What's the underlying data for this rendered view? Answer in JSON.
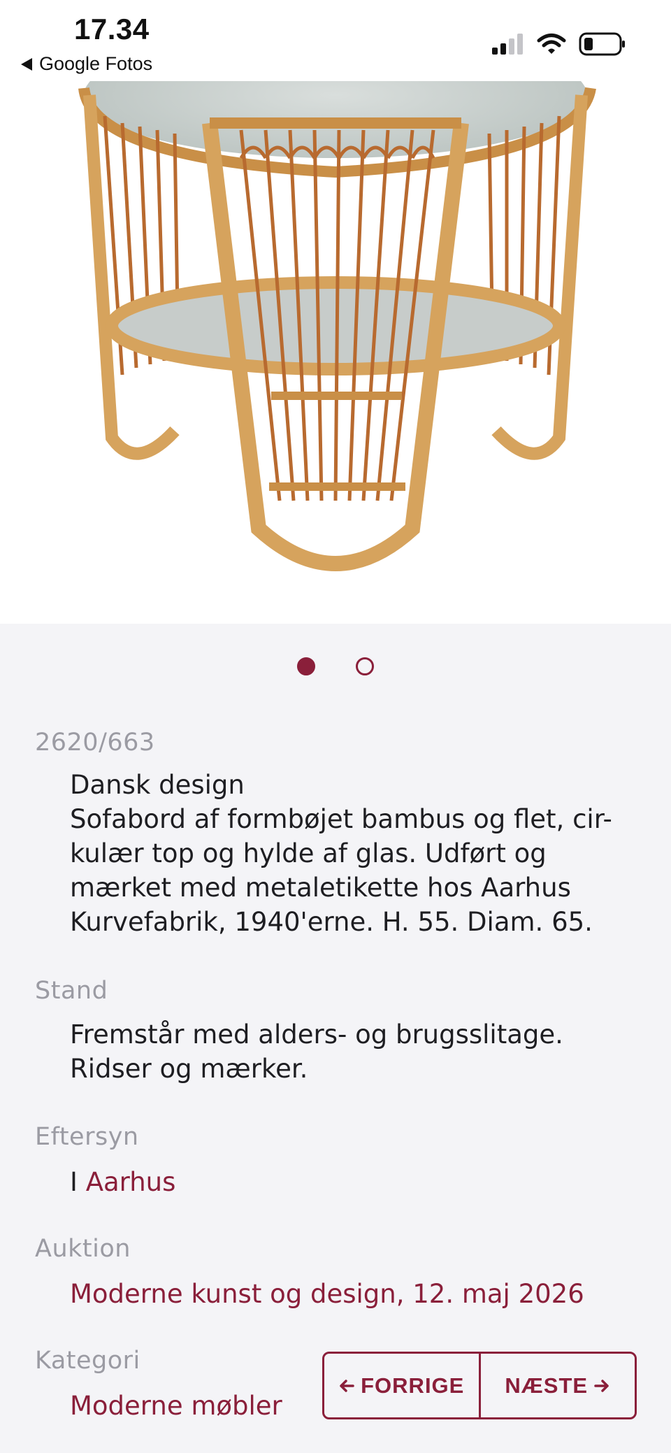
{
  "status_bar": {
    "time": "17.34",
    "back_app": "Google Fotos"
  },
  "colors": {
    "accent": "#8a1f3a",
    "label_gray": "#9b9ba3",
    "background": "#f4f4f7"
  },
  "icons": [
    "back-triangle-icon",
    "signal-icon",
    "wifi-icon",
    "battery-icon",
    "arrow-left-icon",
    "arrow-right-icon"
  ],
  "gallery": {
    "image": "rattan-coffee-table-photo",
    "page_count": 2,
    "active_page": 1
  },
  "lot": {
    "number": "2620/663",
    "title": "Dansk design",
    "description_lines": [
      "Sofabord af formbøjet bambus og flet, cir-",
      "kulær top og hylde af glas. Udført og",
      "mærket med metaletikette hos Aarhus",
      "Kurvefabrik, 1940'erne. H. 55. Diam. 65."
    ]
  },
  "condition": {
    "label": "Stand",
    "lines": [
      "Fremstår med alders- og brugsslitage.",
      "Ridser og mærker."
    ]
  },
  "inspection": {
    "label": "Eftersyn",
    "prefix": "I",
    "location": "Aarhus"
  },
  "auction": {
    "label": "Auktion",
    "value": "Moderne kunst og design, 12. maj 2026"
  },
  "category": {
    "label": "Kategori",
    "value": "Moderne møbler"
  },
  "nav": {
    "prev_label": "FORRIGE",
    "next_label": "NÆSTE"
  }
}
